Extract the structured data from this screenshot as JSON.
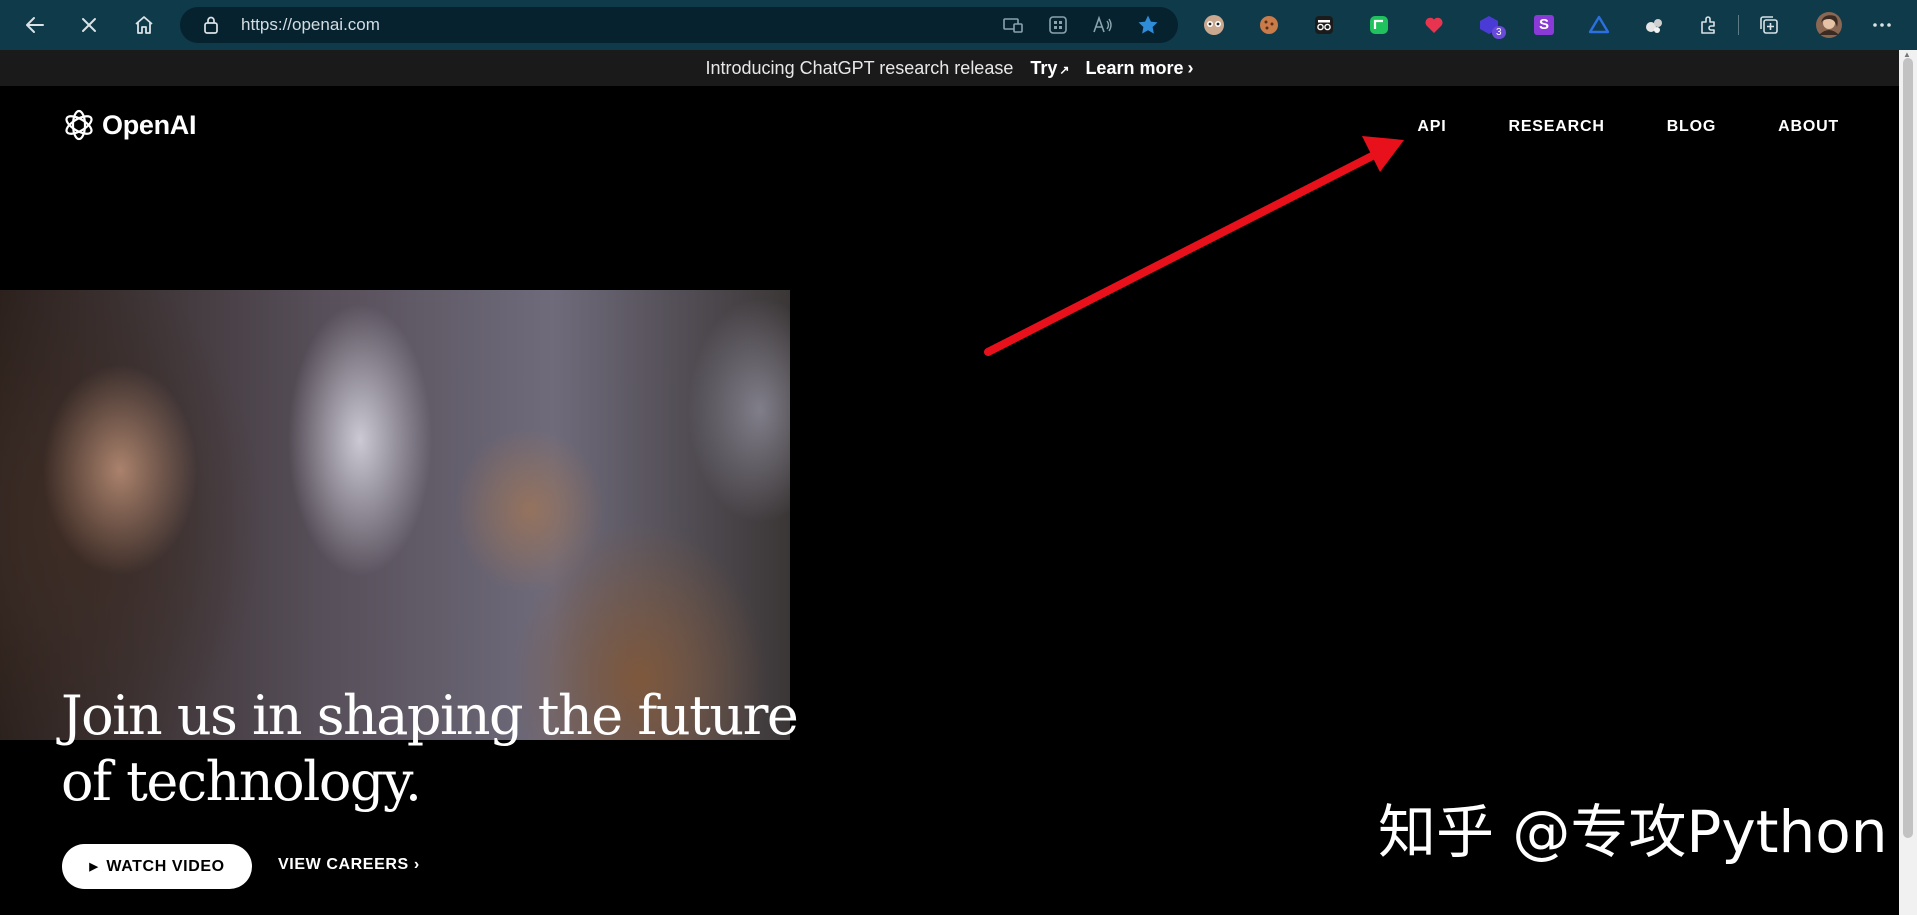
{
  "browser": {
    "url": "https://openai.com"
  },
  "announcement": {
    "text": "Introducing ChatGPT research release",
    "try_label": "Try",
    "learn_more_label": "Learn more"
  },
  "header": {
    "logo_text": "OpenAI",
    "nav": [
      "API",
      "RESEARCH",
      "BLOG",
      "ABOUT"
    ]
  },
  "hero": {
    "title_line1": "Join us in shaping the future",
    "title_line2": "of technology.",
    "watch_video_label": "WATCH VIDEO",
    "view_careers_label": "VIEW CAREERS"
  },
  "extensions": {
    "badge_count": "3",
    "s_letter": "S"
  },
  "watermark": "知乎 @专攻Python",
  "colors": {
    "toolbar": "#0e3a4a",
    "omnibox": "#05222e",
    "page_background": "#000000",
    "announcement_bar": "#1a1a1a",
    "annotation_arrow": "#e8111b",
    "favorite_star": "#2f8cd8"
  },
  "icons": [
    "back-icon",
    "stop-loading-icon",
    "home-icon",
    "lock-icon",
    "app-available-icon",
    "apps-grid-icon",
    "read-aloud-icon",
    "favorite-star-icon",
    "extensions-icon",
    "collections-icon",
    "more-menu-icon"
  ]
}
